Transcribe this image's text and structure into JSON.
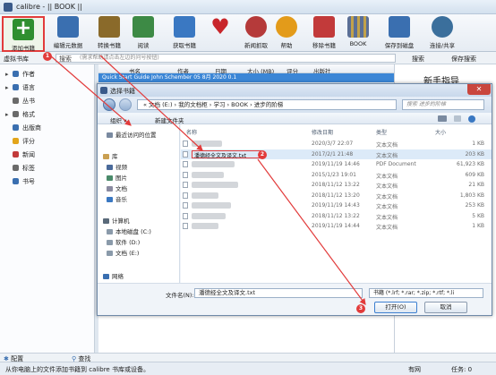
{
  "window": {
    "title": "calibre - || BOOK ||"
  },
  "toolbar": [
    {
      "label": "添加书籍",
      "color": "#2f8f2f"
    },
    {
      "label": "编辑元数据",
      "color": "#3a6fb0"
    },
    {
      "label": "转换书籍",
      "color": "#8a6a2a"
    },
    {
      "label": "阅读",
      "color": "#3d8a45"
    },
    {
      "label": "获取书籍",
      "color": "#3a78c2"
    },
    {
      "label": "",
      "color": "#c8262b"
    },
    {
      "label": "新闻抓取",
      "color": "#b53a3a"
    },
    {
      "label": "帮助",
      "color": "#e39b1a"
    },
    {
      "label": "移除书籍",
      "color": "#c23a3a"
    },
    {
      "label": "BOOK",
      "color": "#5b6f96"
    },
    {
      "label": "保存到磁盘",
      "color": "#3a6fb0"
    },
    {
      "label": "连接/共享",
      "color": "#3b6f9c"
    }
  ],
  "searchbar": {
    "library": "虚拟书库",
    "label": "搜索",
    "placeholder": "(需求帮助请点击左边的问号按钮)",
    "search_btn": "搜索",
    "saved_btn": "保存搜索"
  },
  "sidebar": {
    "items": [
      {
        "label": "作者",
        "color": "#3a6fb0"
      },
      {
        "label": "语言",
        "color": "#3a6fb0"
      },
      {
        "label": "丛书",
        "color": "#6a6a6a"
      },
      {
        "label": "格式",
        "color": "#6a6a6a"
      },
      {
        "label": "出版商",
        "color": "#3a6fb0"
      },
      {
        "label": "评分",
        "color": "#e3a51a"
      },
      {
        "label": "新闻",
        "color": "#c23a3a"
      },
      {
        "label": "标签",
        "color": "#6a6a6a"
      },
      {
        "label": "书号",
        "color": "#3a6fb0"
      }
    ],
    "configure": "配置",
    "find": "查找"
  },
  "booklist": {
    "columns": [
      "书名",
      "作者",
      "日期",
      "大小 (MB)",
      "评分",
      "出版社"
    ],
    "first_row": "Quick Start Guide  John Schember  05 8月 2020    0.1"
  },
  "details": {
    "title": "新手指导"
  },
  "status": {
    "left": "从你电脑上的文件添加书籍到 calibre 书库或设备。",
    "update": "有网",
    "jobs": "任务: 0"
  },
  "dialog": {
    "title": "选择书籍",
    "path": "« 文档 (E:)  ›  我的文档柜  ›  学习  ›  BOOK  ›  进步的阶梯",
    "search_placeholder": "搜索 进步的阶梯",
    "organize": "组织 ▾",
    "new_folder": "新建文件夹",
    "nav": [
      {
        "label": "最近访问的位置",
        "color": "#7a8aa0",
        "indent": 0
      },
      {
        "label": "库",
        "color": "#caa052",
        "indent": -4
      },
      {
        "label": "视频",
        "color": "#4a6a9a",
        "indent": 0
      },
      {
        "label": "图片",
        "color": "#4a8a6a",
        "indent": 0
      },
      {
        "label": "文档",
        "color": "#8a8aa0",
        "indent": 0
      },
      {
        "label": "音乐",
        "color": "#3a78c2",
        "indent": 0
      },
      {
        "label": "计算机",
        "color": "#5a6a7a",
        "indent": -4
      },
      {
        "label": "本地磁盘 (C:)",
        "color": "#8a9aaa",
        "indent": 0
      },
      {
        "label": "软件 (D:)",
        "color": "#8a9aaa",
        "indent": 0
      },
      {
        "label": "文档 (E:)",
        "color": "#8a9aaa",
        "indent": 0
      },
      {
        "label": "网络",
        "color": "#3a6fb0",
        "indent": -4
      }
    ],
    "file_columns": [
      "名称",
      "修改日期",
      "类型",
      "大小"
    ],
    "files": [
      {
        "name": "",
        "date": "2020/3/7 22:07",
        "type": "文本文档",
        "size": "1 KB"
      },
      {
        "name": "潘德经全文及译文.txt",
        "date": "2017/2/1 21:48",
        "type": "文本文档",
        "size": "203 KB",
        "selected": true
      },
      {
        "name": "",
        "date": "2019/11/19 14:46",
        "type": "PDF Document",
        "size": "61,923 KB"
      },
      {
        "name": "",
        "date": "2015/1/23 19:01",
        "type": "文本文档",
        "size": "609 KB"
      },
      {
        "name": "",
        "date": "2018/11/12 13:22",
        "type": "文本文档",
        "size": "21 KB"
      },
      {
        "name": "",
        "date": "2018/11/12 13:20",
        "type": "文本文档",
        "size": "1,803 KB"
      },
      {
        "name": "",
        "date": "2019/11/19 14:43",
        "type": "文本文档",
        "size": "253 KB"
      },
      {
        "name": "",
        "date": "2018/11/12 13:22",
        "type": "文本文档",
        "size": "5 KB"
      },
      {
        "name": "",
        "date": "2019/11/19 14:44",
        "type": "文本文档",
        "size": "1 KB"
      }
    ],
    "filename_label": "文件名(N):",
    "filename": "潘德经全文及译文.txt",
    "filetype": "书籍 (*.lrf; *.rar; *.zip; *.rtf; *.li",
    "open": "打开(O)",
    "cancel": "取消"
  },
  "badges": [
    "1",
    "2",
    "3"
  ],
  "accent": "#e23b3b"
}
